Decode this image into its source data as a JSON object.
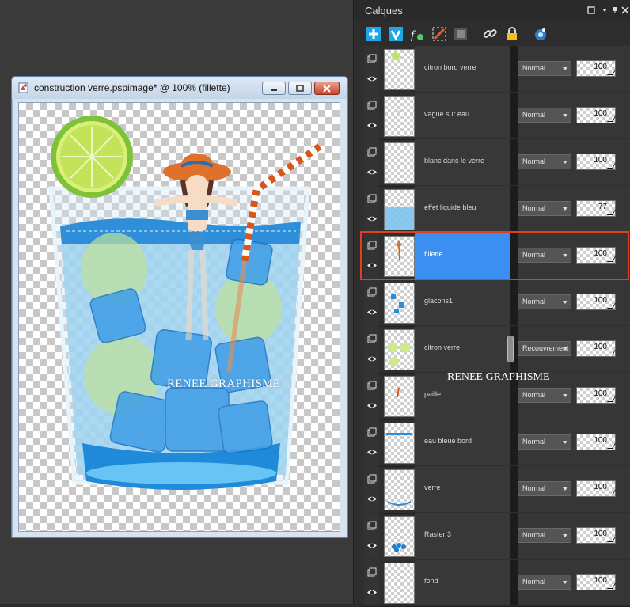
{
  "document_window": {
    "title": "construction verre.pspimage* @ 100% (fillette)",
    "watermark": "RENEE GRAPHISME"
  },
  "layers_panel": {
    "title": "Calques",
    "watermark": "RENEE GRAPHISME",
    "toolbar_icons": [
      "new-raster-layer-icon",
      "new-vector-layer-icon",
      "layer-effects-icon",
      "edit-selection-icon",
      "mask-icon",
      "link-icon",
      "lock-icon",
      "layer-visibility-toggle-icon"
    ],
    "layers": [
      {
        "name": "citron bord verre",
        "blend": "Normal",
        "opacity": "100"
      },
      {
        "name": "vague sur eau",
        "blend": "Normal",
        "opacity": "100"
      },
      {
        "name": "blanc dans le verre",
        "blend": "Normal",
        "opacity": "100"
      },
      {
        "name": "effet liquide bleu",
        "blend": "Normal",
        "opacity": "77"
      },
      {
        "name": "fillette",
        "blend": "Normal",
        "opacity": "100",
        "selected": true
      },
      {
        "name": "glacons1",
        "blend": "Normal",
        "opacity": "100"
      },
      {
        "name": "citron verre",
        "blend": "Recouvrement",
        "opacity": "100"
      },
      {
        "name": "paille",
        "blend": "Normal",
        "opacity": "100"
      },
      {
        "name": "eau bleue bord",
        "blend": "Normal",
        "opacity": "100"
      },
      {
        "name": "verre",
        "blend": "Normal",
        "opacity": "100"
      },
      {
        "name": "Raster 3",
        "blend": "Normal",
        "opacity": "100"
      },
      {
        "name": "fond",
        "blend": "Normal",
        "opacity": "100"
      }
    ]
  },
  "colors": {
    "selection_blue": "#3b8ff0",
    "selection_outline": "#e0401c",
    "glass_water": "#3aa0e6",
    "lemon": "#a6d83a",
    "straw_orange": "#d9561b"
  }
}
